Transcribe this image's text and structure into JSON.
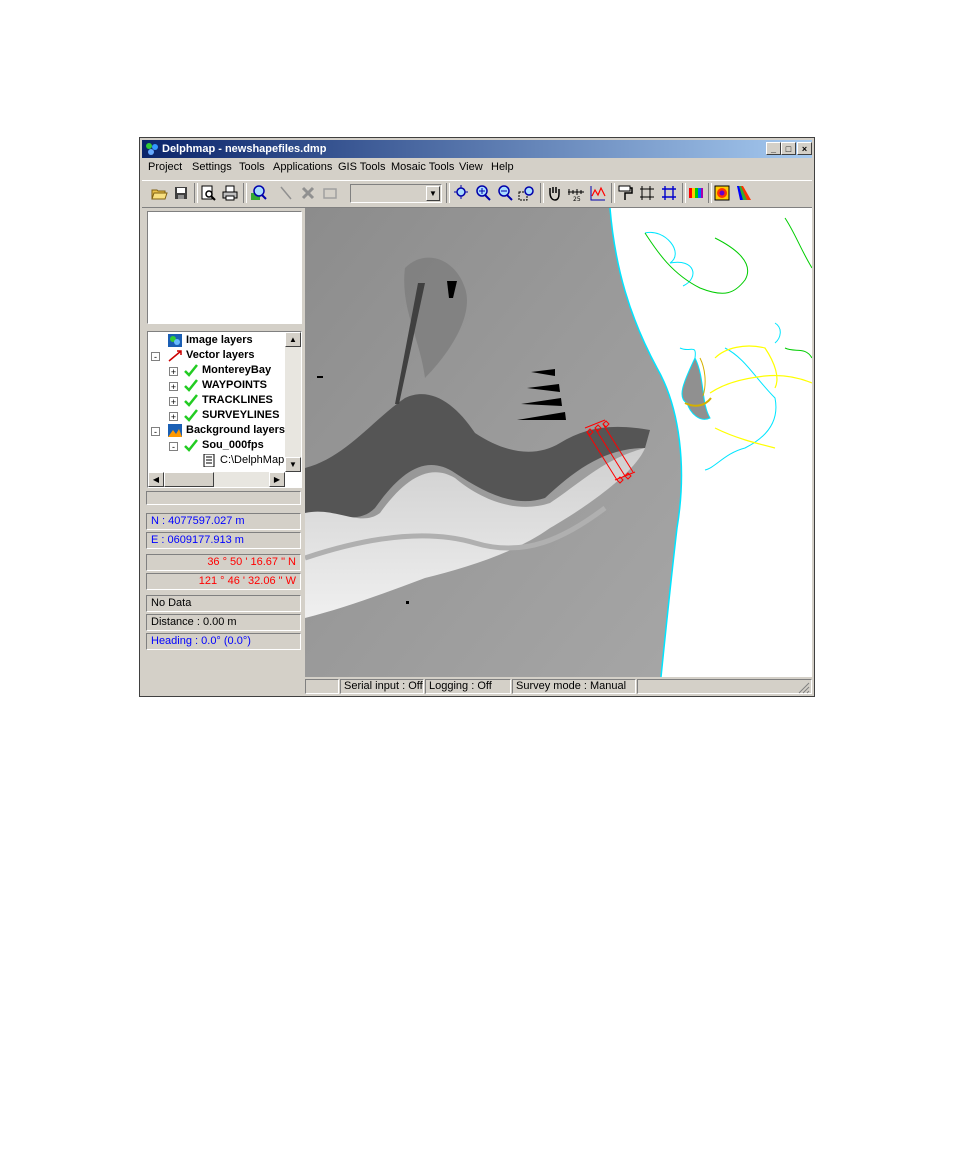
{
  "window": {
    "title": "Delphmap - newshapefiles.dmp",
    "minimize": "_",
    "maximize": "□",
    "close": "×"
  },
  "menu": [
    "Project",
    "Settings",
    "Tools",
    "Applications",
    "GIS Tools",
    "Mosaic Tools",
    "View",
    "Help"
  ],
  "toolbar": {
    "combo_value": "",
    "icons": [
      "open-folder-icon",
      "save-icon",
      "print-preview-icon",
      "print-icon",
      "zoom-layer-icon",
      "line-tool-icon",
      "delete-icon",
      "rectangle-icon",
      "zoom-extent-icon",
      "zoom-in-icon",
      "zoom-out-icon",
      "zoom-window-icon",
      "pan-hand-icon",
      "scale-icon",
      "profile-chart-icon",
      "paint-roller-icon",
      "grid-icon",
      "graticule-icon",
      "color-palette-icon",
      "color-map-icon",
      "color-ramp-icon"
    ],
    "scale_label": "25"
  },
  "tree": {
    "nodes": [
      {
        "label": "Image layers",
        "icon": "image-layers-icon"
      },
      {
        "label": "Vector layers",
        "icon": "vector-layers-icon"
      },
      {
        "label": "MontereyBay",
        "icon": "check-icon"
      },
      {
        "label": "WAYPOINTS",
        "icon": "check-icon"
      },
      {
        "label": "TRACKLINES",
        "icon": "check-icon"
      },
      {
        "label": "SURVEYLINES",
        "icon": "check-icon"
      },
      {
        "label": "Background layers",
        "icon": "background-layers-icon"
      },
      {
        "label": "Sou_000fps",
        "icon": "check-icon"
      },
      {
        "label": "C:\\DelphMapD",
        "icon": "file-icon"
      }
    ],
    "expanders": [
      "-",
      "+",
      "+",
      "+",
      "+",
      "-",
      "-"
    ]
  },
  "coords": {
    "northing": "N : 4077597.027 m",
    "easting": "E : 0609177.913 m",
    "lat": "36 ° 50 ' 16.67 \" N",
    "lon": "121 ° 46 ' 32.06 \" W",
    "data": "No Data",
    "distance": "Distance : 0.00 m",
    "heading": "Heading : 0.0° (0.0°)"
  },
  "status": {
    "serial": "Serial input : Off",
    "logging": "Logging : Off",
    "survey": "Survey mode : Manual"
  },
  "colors": {
    "coast": "#00e5ff",
    "land_line_green": "#00cc00",
    "land_line_yellow": "#ffff00",
    "survey_red": "#ff0000",
    "title_start": "#0a246a",
    "title_end": "#a6caf0"
  }
}
